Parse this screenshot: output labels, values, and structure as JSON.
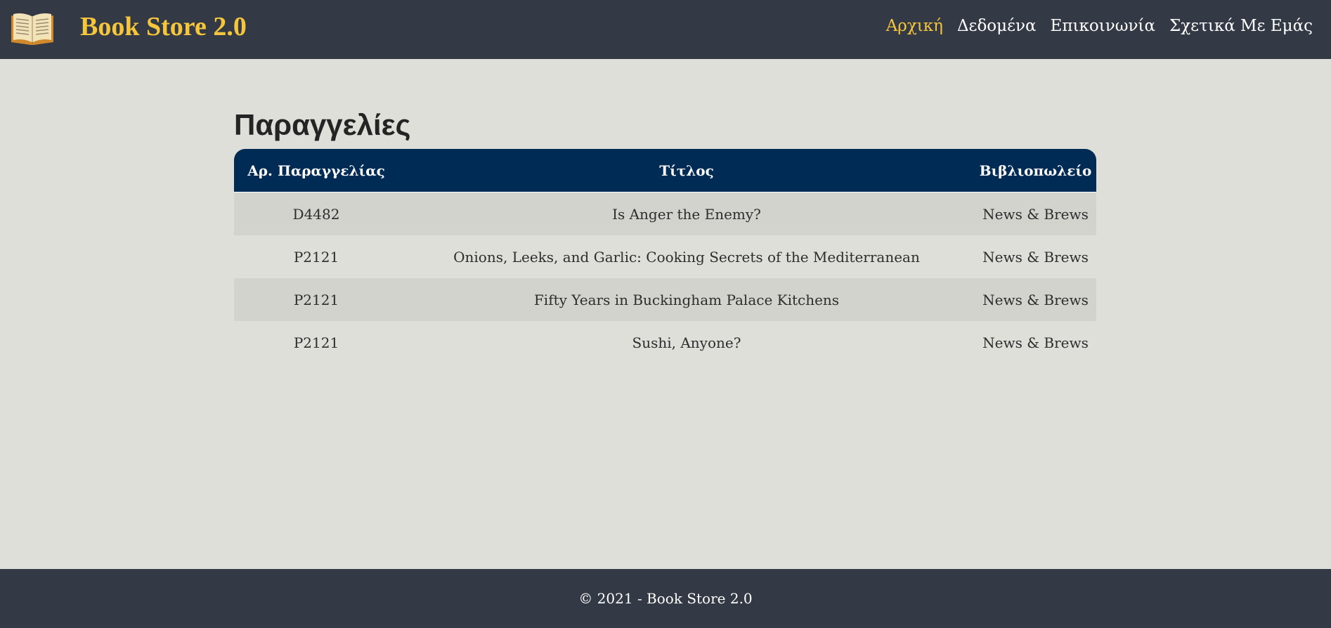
{
  "header": {
    "logo_icon": "open-book-icon",
    "brand": "Book Store 2.0",
    "nav": [
      {
        "label": "Αρχική",
        "active": true
      },
      {
        "label": "Δεδομένα",
        "active": false
      },
      {
        "label": "Επικοινωνία",
        "active": false
      },
      {
        "label": "Σχετικά Με Εμάς",
        "active": false
      }
    ],
    "brand_color": "#f5c53b",
    "bar_color": "#343a45"
  },
  "main": {
    "title": "Παραγγελίες",
    "table": {
      "header_color": "#002b55",
      "columns": [
        "Αρ. Παραγγελίας",
        "Τίτλος",
        "Βιβλιοπωλείο"
      ],
      "rows": [
        [
          "D4482",
          "Is Anger the Enemy?",
          "News & Brews"
        ],
        [
          "P2121",
          "Onions, Leeks, and Garlic: Cooking Secrets of the Mediterranean",
          "News & Brews"
        ],
        [
          "P2121",
          "Fifty Years in Buckingham Palace Kitchens",
          "News & Brews"
        ],
        [
          "P2121",
          "Sushi, Anyone?",
          "News & Brews"
        ]
      ]
    }
  },
  "footer": {
    "text": "© 2021 - Book Store 2.0"
  }
}
